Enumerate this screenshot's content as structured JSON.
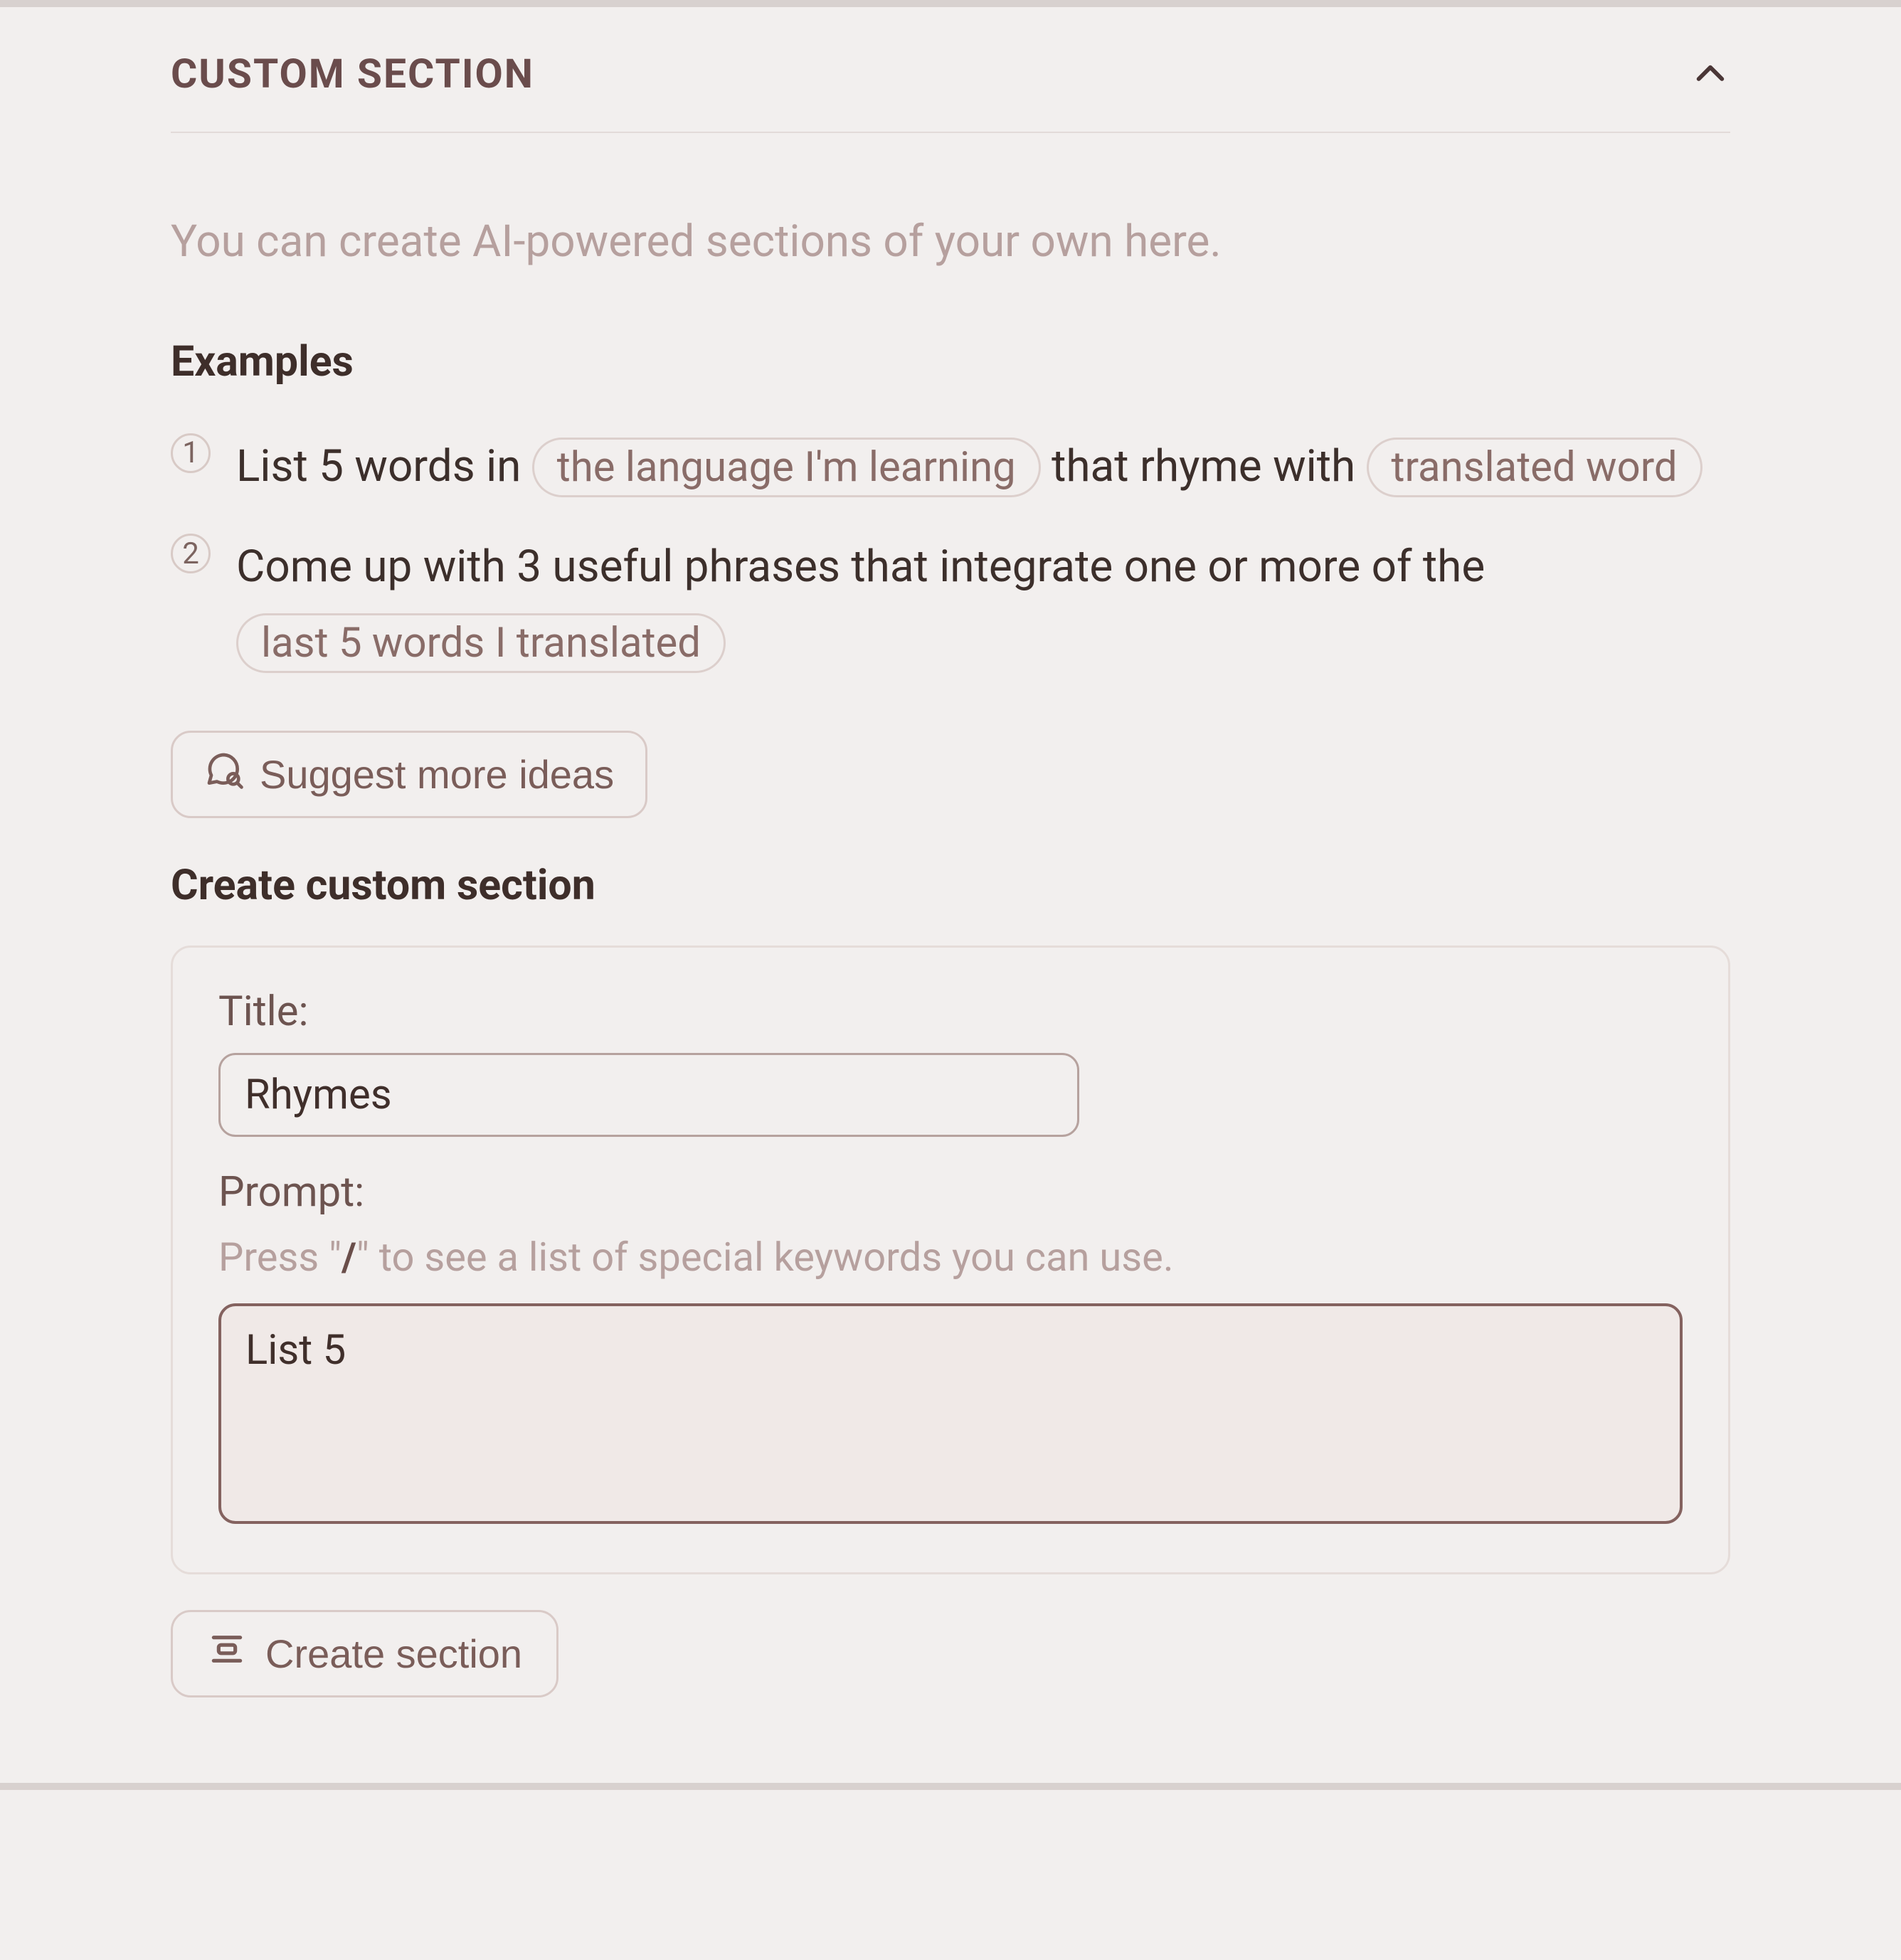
{
  "header": {
    "title": "CUSTOM SECTION"
  },
  "intro": "You can create AI-powered sections of your own here.",
  "examples": {
    "heading": "Examples",
    "items": [
      {
        "num": "1",
        "part1": "List 5 words in ",
        "pill1": "the language I'm learning",
        "part2": " that rhyme with ",
        "pill2": "translated word"
      },
      {
        "num": "2",
        "part1": "Come up with 3 useful phrases that integrate one or more of the ",
        "pill1": "last 5 words I translated"
      }
    ],
    "suggest_label": "Suggest more ideas"
  },
  "create": {
    "heading": "Create custom section",
    "title_label": "Title:",
    "title_value": "Rhymes",
    "prompt_label": "Prompt:",
    "hint_prefix": "Press \"",
    "hint_slash": "/",
    "hint_suffix": "\" to see a list of special keywords you can use.",
    "prompt_value": "List 5",
    "button_label": "Create section"
  }
}
